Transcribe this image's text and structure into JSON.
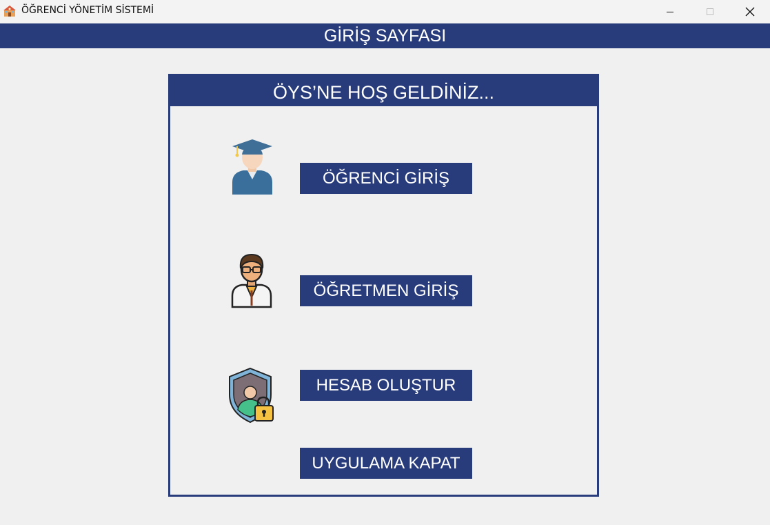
{
  "window": {
    "title": "ÖĞRENCİ YÖNETİM SİSTEMİ",
    "icon": "school-building-icon",
    "controls": [
      "minimize-icon",
      "maximize-icon",
      "close-icon"
    ]
  },
  "header": {
    "title": "GİRİŞ SAYFASI"
  },
  "panel": {
    "title": "ÖYS’NE  HOŞ GELDİNİZ...",
    "buttons": [
      {
        "label": "ÖĞRENCİ GİRİŞ",
        "icon": "graduate-student-icon"
      },
      {
        "label": "ÖĞRETMEN GİRİŞ",
        "icon": "teacher-icon"
      },
      {
        "label": "HESAB OLUŞTUR",
        "icon": "shield-user-lock-icon"
      },
      {
        "label": "UYGULAMA KAPAT"
      }
    ]
  },
  "colors": {
    "accent": "#283b7b",
    "background": "#f0f0f0",
    "text_on_accent": "#ffffff"
  }
}
